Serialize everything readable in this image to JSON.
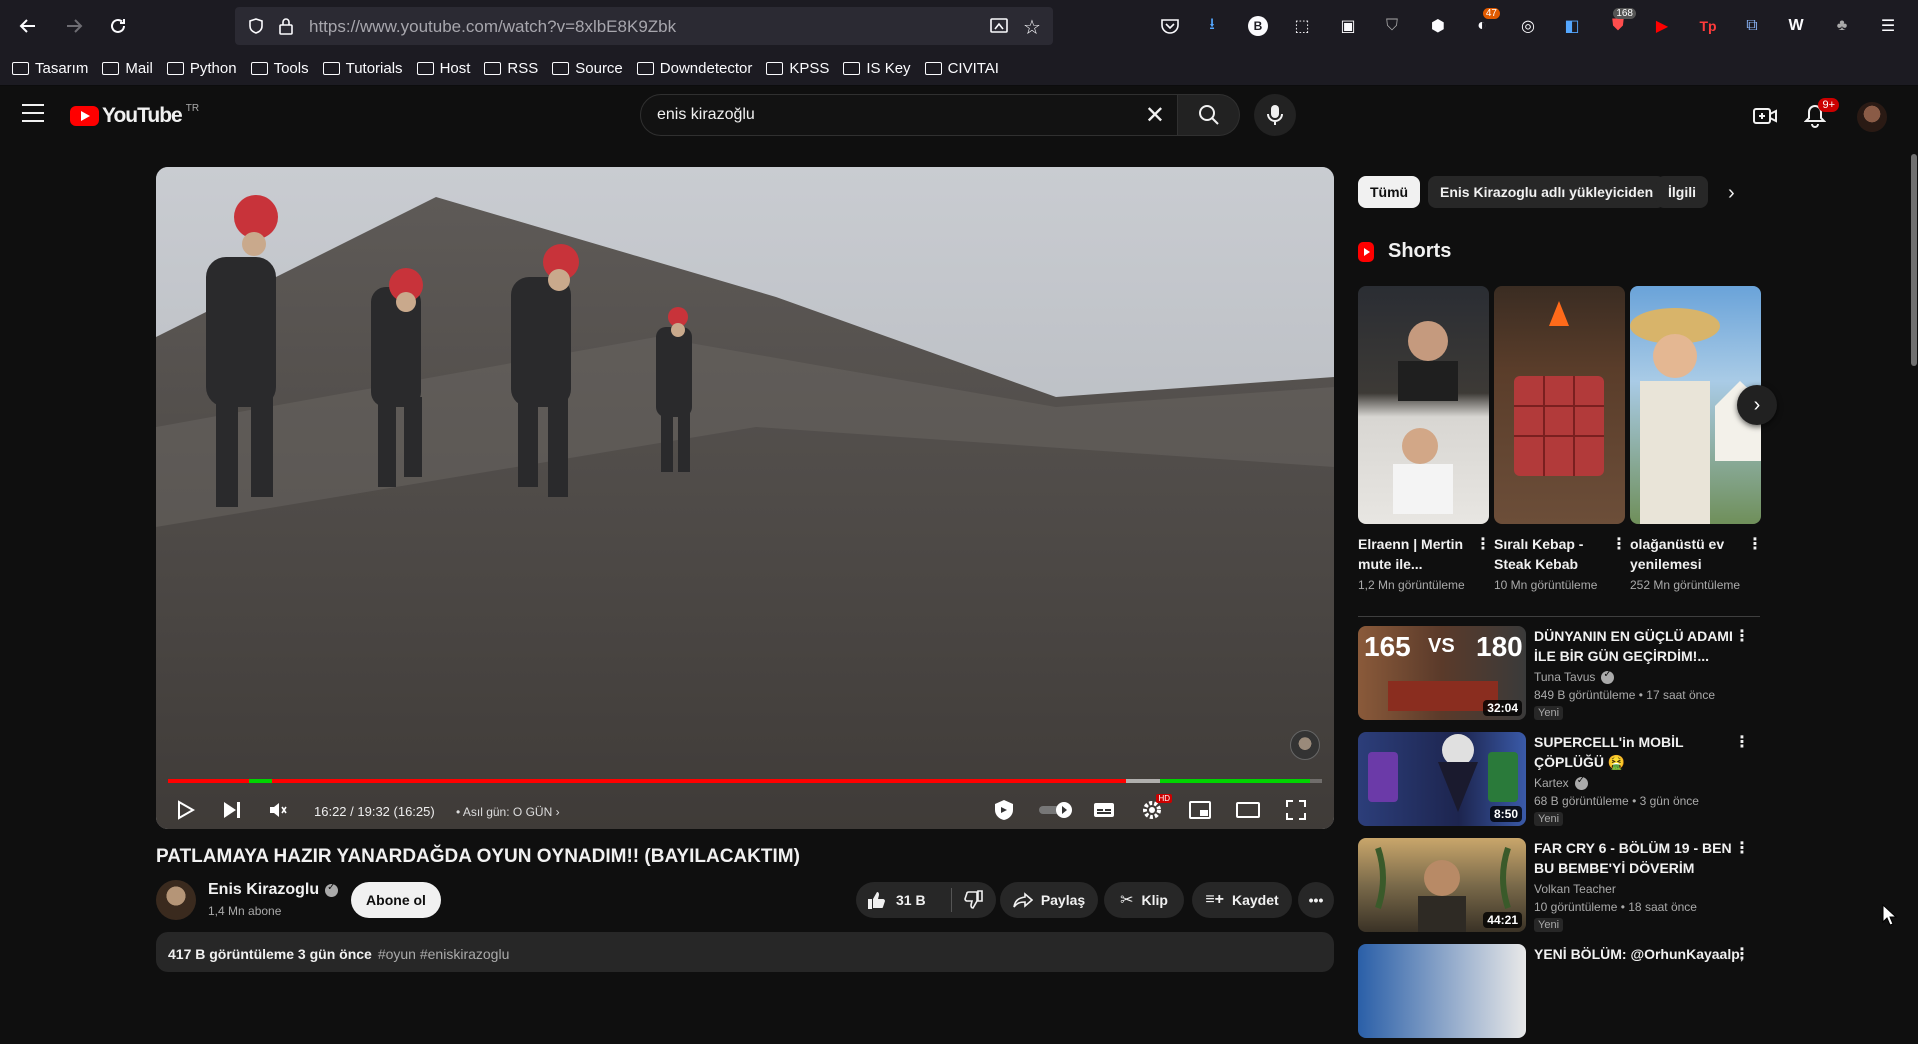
{
  "browser": {
    "url_prefix": "https://www.youtube.com",
    "url_path": "/watch?v=8xlbE8K9Zbk",
    "extension_badges": {
      "first": "47",
      "second": "168"
    }
  },
  "bookmarks": [
    "Tasarım",
    "Mail",
    "Python",
    "Tools",
    "Tutorials",
    "Host",
    "RSS",
    "Source",
    "Downdetector",
    "KPSS",
    "IS Key",
    "CIVITAI"
  ],
  "youtube": {
    "logo_text": "YouTube",
    "region": "TR",
    "search_query": "enis kirazoğlu",
    "notifications_badge": "9+"
  },
  "player": {
    "time": "16:22 / 19:32 (16:25)",
    "chapter": "• Asıl gün: O GÜN",
    "progress_played": 0.83,
    "progress_loaded": 0.86,
    "sponsor_segments": [
      [
        0.07,
        0.09
      ],
      [
        0.86,
        0.99
      ]
    ],
    "hd_badge": "HD"
  },
  "video": {
    "title": "PATLAMAYA HAZIR YANARDAĞDA OYUN OYNADIM!! (BAYILACAKTIM)",
    "channel": "Enis Kirazoglu",
    "subscribers": "1,4 Mn abone",
    "subscribe_label": "Abone ol",
    "likes": "31 B",
    "share_label": "Paylaş",
    "clip_label": "Klip",
    "save_label": "Kaydet",
    "desc_meta": "417 B görüntüleme  3 gün önce",
    "desc_tags": "#oyun #eniskirazoglu"
  },
  "sidebar": {
    "chips": [
      "Tümü",
      "Enis Kirazoglu adlı yükleyiciden",
      "İlgili"
    ],
    "shorts_title": "Shorts",
    "shorts": [
      {
        "title": "Elraenn | Mertin mute ile...",
        "views": "1,2 Mn görüntüleme"
      },
      {
        "title": "Sıralı Kebap - Steak Kebab",
        "views": "10 Mn görüntüleme"
      },
      {
        "title": "olağanüstü ev yenilemesi",
        "views": "252 Mn görüntüleme"
      }
    ],
    "videos": [
      {
        "title": "DÜNYANIN EN GÜÇLÜ ADAMI İLE BİR GÜN GEÇİRDİM!...",
        "channel": "Tuna Tavus",
        "meta": "849 B görüntüleme  • 17 saat önce",
        "badge": "Yeni",
        "duration": "32:04",
        "verified": true
      },
      {
        "title": "SUPERCELL'in MOBİL ÇÖPLÜĞÜ 🤮",
        "channel": "Kartex",
        "meta": "68 B görüntüleme  • 3 gün önce",
        "badge": "Yeni",
        "duration": "8:50",
        "verified": true
      },
      {
        "title": "FAR CRY 6 - BÖLÜM 19 - BEN BU BEMBE'Yİ DÖVERİM",
        "channel": "Volkan Teacher",
        "meta": "10 görüntüleme  • 18 saat önce",
        "badge": "Yeni",
        "duration": "44:21",
        "verified": false
      },
      {
        "title": "YENİ BÖLÜM: @OrhunKayaalp,",
        "channel": "",
        "meta": "",
        "badge": "",
        "duration": "",
        "verified": false
      }
    ]
  }
}
